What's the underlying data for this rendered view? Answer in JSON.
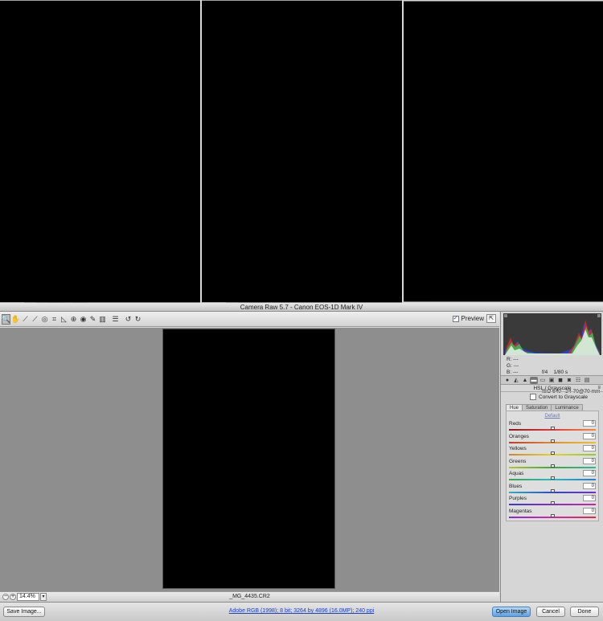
{
  "window": {
    "title": "Camera Raw 5.7  -  Canon EOS-1D Mark IV"
  },
  "toolbar": {
    "tools": [
      {
        "name": "zoom-tool-icon",
        "glyph": "🔍",
        "selected": true
      },
      {
        "name": "hand-tool-icon",
        "glyph": "✋"
      },
      {
        "name": "white-balance-tool-icon",
        "glyph": "⟋"
      },
      {
        "name": "color-sampler-tool-icon",
        "glyph": "⟋"
      },
      {
        "name": "targeted-adjustment-tool-icon",
        "glyph": "◎"
      },
      {
        "name": "crop-tool-icon",
        "glyph": "⌗"
      },
      {
        "name": "straighten-tool-icon",
        "glyph": "◺"
      },
      {
        "name": "spot-removal-tool-icon",
        "glyph": "⊕"
      },
      {
        "name": "red-eye-tool-icon",
        "glyph": "◉"
      },
      {
        "name": "adjustment-brush-icon",
        "glyph": "✎"
      },
      {
        "name": "graduated-filter-icon",
        "glyph": "▥"
      },
      {
        "name": "preferences-icon",
        "glyph": "☰"
      },
      {
        "name": "rotate-left-icon",
        "glyph": "↺"
      },
      {
        "name": "rotate-right-icon",
        "glyph": "↻"
      }
    ],
    "preview_label": "Preview",
    "preview_checked": true
  },
  "status": {
    "zoom_out": "−",
    "zoom_in": "+",
    "zoom": "14.4%",
    "filename": "_MG_4435.CR2"
  },
  "info": {
    "r": "R:   ---",
    "g": "G:   ---",
    "b": "B:   ---",
    "aperture": "f/4",
    "shutter": "1/80 s",
    "iso": "ISO 640",
    "lens": "24-70@70 mm"
  },
  "panel": {
    "title": "HSL / Grayscale",
    "menu_icon": "≡",
    "convert_label": "Convert to Grayscale",
    "convert_checked": false,
    "tabs": [
      "Hue",
      "Saturation",
      "Luminance"
    ],
    "active_tab": "Hue",
    "default_label": "Default",
    "sliders": [
      {
        "label": "Reds",
        "value": "0",
        "pos": 0.5,
        "colors": [
          "#8a1c1c",
          "#e03a3a",
          "#f08a3a"
        ]
      },
      {
        "label": "Oranges",
        "value": "0",
        "pos": 0.5,
        "colors": [
          "#c03a2a",
          "#e58a2a",
          "#e8c42a"
        ]
      },
      {
        "label": "Yellows",
        "value": "0",
        "pos": 0.5,
        "colors": [
          "#d0852a",
          "#e8d22a",
          "#8fcb3a"
        ]
      },
      {
        "label": "Greens",
        "value": "0",
        "pos": 0.5,
        "colors": [
          "#b8c42a",
          "#3fa83a",
          "#2fb8a0"
        ]
      },
      {
        "label": "Aquas",
        "value": "0",
        "pos": 0.5,
        "colors": [
          "#3aa84a",
          "#2ab8c4",
          "#2a7ad0"
        ]
      },
      {
        "label": "Blues",
        "value": "0",
        "pos": 0.5,
        "colors": [
          "#2ab0c4",
          "#2a4ad0",
          "#7a2ad0"
        ]
      },
      {
        "label": "Purples",
        "value": "0",
        "pos": 0.5,
        "colors": [
          "#3a3ad0",
          "#8a2ac4",
          "#c42aa8"
        ]
      },
      {
        "label": "Magentas",
        "value": "0",
        "pos": 0.5,
        "colors": [
          "#8a2ad0",
          "#d02aa8",
          "#e02a4a"
        ]
      }
    ]
  },
  "bottom": {
    "save_label": "Save Image...",
    "workflow": "Adobe RGB (1998); 8 bit; 3264 by 4896 (16.0MP); 240 ppi",
    "open_label": "Open Image",
    "cancel_label": "Cancel",
    "done_label": "Done"
  }
}
